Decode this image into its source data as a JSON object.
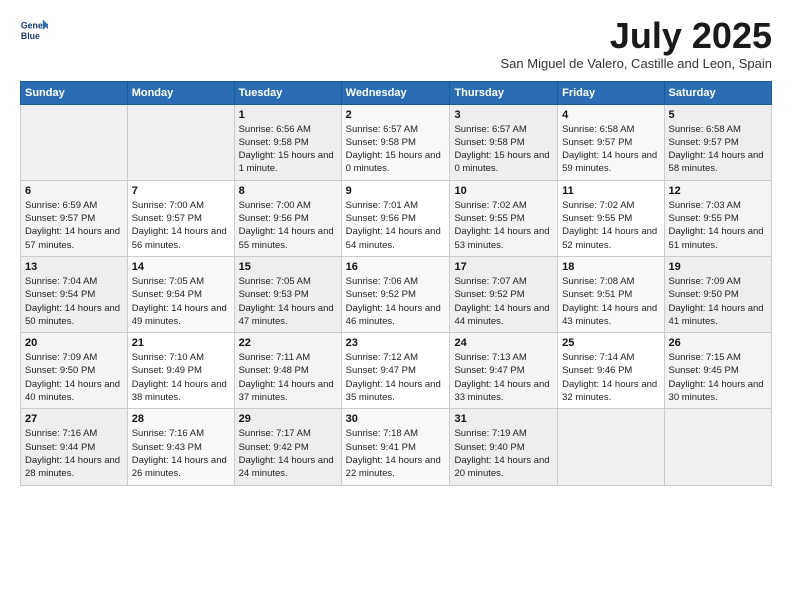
{
  "logo": {
    "line1": "General",
    "line2": "Blue"
  },
  "title": "July 2025",
  "subtitle": "San Miguel de Valero, Castille and Leon, Spain",
  "weekdays": [
    "Sunday",
    "Monday",
    "Tuesday",
    "Wednesday",
    "Thursday",
    "Friday",
    "Saturday"
  ],
  "weeks": [
    [
      {
        "day": "",
        "sunrise": "",
        "sunset": "",
        "daylight": ""
      },
      {
        "day": "",
        "sunrise": "",
        "sunset": "",
        "daylight": ""
      },
      {
        "day": "1",
        "sunrise": "Sunrise: 6:56 AM",
        "sunset": "Sunset: 9:58 PM",
        "daylight": "Daylight: 15 hours and 1 minute."
      },
      {
        "day": "2",
        "sunrise": "Sunrise: 6:57 AM",
        "sunset": "Sunset: 9:58 PM",
        "daylight": "Daylight: 15 hours and 0 minutes."
      },
      {
        "day": "3",
        "sunrise": "Sunrise: 6:57 AM",
        "sunset": "Sunset: 9:58 PM",
        "daylight": "Daylight: 15 hours and 0 minutes."
      },
      {
        "day": "4",
        "sunrise": "Sunrise: 6:58 AM",
        "sunset": "Sunset: 9:57 PM",
        "daylight": "Daylight: 14 hours and 59 minutes."
      },
      {
        "day": "5",
        "sunrise": "Sunrise: 6:58 AM",
        "sunset": "Sunset: 9:57 PM",
        "daylight": "Daylight: 14 hours and 58 minutes."
      }
    ],
    [
      {
        "day": "6",
        "sunrise": "Sunrise: 6:59 AM",
        "sunset": "Sunset: 9:57 PM",
        "daylight": "Daylight: 14 hours and 57 minutes."
      },
      {
        "day": "7",
        "sunrise": "Sunrise: 7:00 AM",
        "sunset": "Sunset: 9:57 PM",
        "daylight": "Daylight: 14 hours and 56 minutes."
      },
      {
        "day": "8",
        "sunrise": "Sunrise: 7:00 AM",
        "sunset": "Sunset: 9:56 PM",
        "daylight": "Daylight: 14 hours and 55 minutes."
      },
      {
        "day": "9",
        "sunrise": "Sunrise: 7:01 AM",
        "sunset": "Sunset: 9:56 PM",
        "daylight": "Daylight: 14 hours and 54 minutes."
      },
      {
        "day": "10",
        "sunrise": "Sunrise: 7:02 AM",
        "sunset": "Sunset: 9:55 PM",
        "daylight": "Daylight: 14 hours and 53 minutes."
      },
      {
        "day": "11",
        "sunrise": "Sunrise: 7:02 AM",
        "sunset": "Sunset: 9:55 PM",
        "daylight": "Daylight: 14 hours and 52 minutes."
      },
      {
        "day": "12",
        "sunrise": "Sunrise: 7:03 AM",
        "sunset": "Sunset: 9:55 PM",
        "daylight": "Daylight: 14 hours and 51 minutes."
      }
    ],
    [
      {
        "day": "13",
        "sunrise": "Sunrise: 7:04 AM",
        "sunset": "Sunset: 9:54 PM",
        "daylight": "Daylight: 14 hours and 50 minutes."
      },
      {
        "day": "14",
        "sunrise": "Sunrise: 7:05 AM",
        "sunset": "Sunset: 9:54 PM",
        "daylight": "Daylight: 14 hours and 49 minutes."
      },
      {
        "day": "15",
        "sunrise": "Sunrise: 7:05 AM",
        "sunset": "Sunset: 9:53 PM",
        "daylight": "Daylight: 14 hours and 47 minutes."
      },
      {
        "day": "16",
        "sunrise": "Sunrise: 7:06 AM",
        "sunset": "Sunset: 9:52 PM",
        "daylight": "Daylight: 14 hours and 46 minutes."
      },
      {
        "day": "17",
        "sunrise": "Sunrise: 7:07 AM",
        "sunset": "Sunset: 9:52 PM",
        "daylight": "Daylight: 14 hours and 44 minutes."
      },
      {
        "day": "18",
        "sunrise": "Sunrise: 7:08 AM",
        "sunset": "Sunset: 9:51 PM",
        "daylight": "Daylight: 14 hours and 43 minutes."
      },
      {
        "day": "19",
        "sunrise": "Sunrise: 7:09 AM",
        "sunset": "Sunset: 9:50 PM",
        "daylight": "Daylight: 14 hours and 41 minutes."
      }
    ],
    [
      {
        "day": "20",
        "sunrise": "Sunrise: 7:09 AM",
        "sunset": "Sunset: 9:50 PM",
        "daylight": "Daylight: 14 hours and 40 minutes."
      },
      {
        "day": "21",
        "sunrise": "Sunrise: 7:10 AM",
        "sunset": "Sunset: 9:49 PM",
        "daylight": "Daylight: 14 hours and 38 minutes."
      },
      {
        "day": "22",
        "sunrise": "Sunrise: 7:11 AM",
        "sunset": "Sunset: 9:48 PM",
        "daylight": "Daylight: 14 hours and 37 minutes."
      },
      {
        "day": "23",
        "sunrise": "Sunrise: 7:12 AM",
        "sunset": "Sunset: 9:47 PM",
        "daylight": "Daylight: 14 hours and 35 minutes."
      },
      {
        "day": "24",
        "sunrise": "Sunrise: 7:13 AM",
        "sunset": "Sunset: 9:47 PM",
        "daylight": "Daylight: 14 hours and 33 minutes."
      },
      {
        "day": "25",
        "sunrise": "Sunrise: 7:14 AM",
        "sunset": "Sunset: 9:46 PM",
        "daylight": "Daylight: 14 hours and 32 minutes."
      },
      {
        "day": "26",
        "sunrise": "Sunrise: 7:15 AM",
        "sunset": "Sunset: 9:45 PM",
        "daylight": "Daylight: 14 hours and 30 minutes."
      }
    ],
    [
      {
        "day": "27",
        "sunrise": "Sunrise: 7:16 AM",
        "sunset": "Sunset: 9:44 PM",
        "daylight": "Daylight: 14 hours and 28 minutes."
      },
      {
        "day": "28",
        "sunrise": "Sunrise: 7:16 AM",
        "sunset": "Sunset: 9:43 PM",
        "daylight": "Daylight: 14 hours and 26 minutes."
      },
      {
        "day": "29",
        "sunrise": "Sunrise: 7:17 AM",
        "sunset": "Sunset: 9:42 PM",
        "daylight": "Daylight: 14 hours and 24 minutes."
      },
      {
        "day": "30",
        "sunrise": "Sunrise: 7:18 AM",
        "sunset": "Sunset: 9:41 PM",
        "daylight": "Daylight: 14 hours and 22 minutes."
      },
      {
        "day": "31",
        "sunrise": "Sunrise: 7:19 AM",
        "sunset": "Sunset: 9:40 PM",
        "daylight": "Daylight: 14 hours and 20 minutes."
      },
      {
        "day": "",
        "sunrise": "",
        "sunset": "",
        "daylight": ""
      },
      {
        "day": "",
        "sunrise": "",
        "sunset": "",
        "daylight": ""
      }
    ]
  ]
}
